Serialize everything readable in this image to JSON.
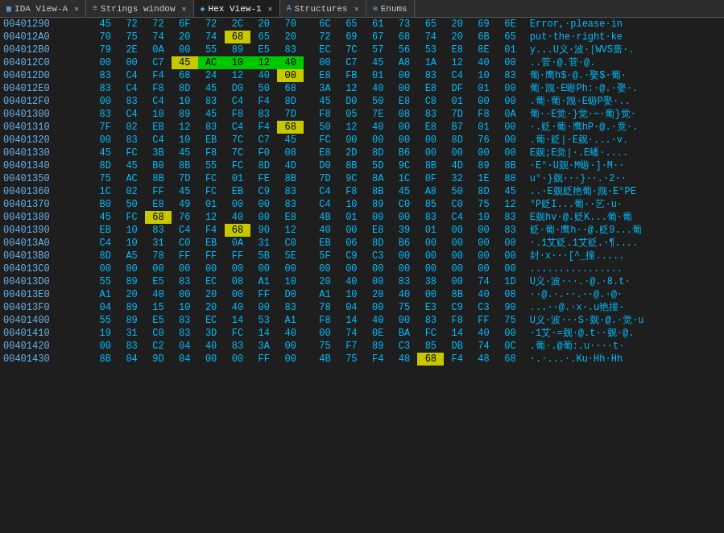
{
  "tabs": [
    {
      "id": "ida-view",
      "icon": "▦",
      "label": "IDA View-A",
      "active": false
    },
    {
      "id": "strings-window",
      "icon": "≡",
      "label": "Strings window",
      "active": false
    },
    {
      "id": "hex-view",
      "icon": "◈",
      "label": "Hex View-1",
      "active": true
    },
    {
      "id": "structures",
      "icon": "A",
      "label": "Structures",
      "active": false
    },
    {
      "id": "enums",
      "icon": "≋",
      "label": "Enums",
      "active": false
    }
  ],
  "rows": [
    {
      "addr": "00401290",
      "bytes": [
        "45",
        "72",
        "72",
        "6F",
        "72",
        "2C",
        "20",
        "70",
        "6C",
        "65",
        "61",
        "73",
        "65",
        "20",
        "69",
        "6E"
      ],
      "highlight": [],
      "ascii": "Error,·please·in"
    },
    {
      "addr": "004012A0",
      "bytes": [
        "70",
        "75",
        "74",
        "20",
        "74",
        "68",
        "65",
        "20",
        "72",
        "69",
        "67",
        "68",
        "74",
        "20",
        "6B",
        "65"
      ],
      "highlight": [
        5,
        11
      ],
      "ascii": "put·the·right·ke"
    },
    {
      "addr": "004012B0",
      "bytes": [
        "79",
        "2E",
        "0A",
        "00",
        "55",
        "89",
        "E5",
        "83",
        "EC",
        "7C",
        "57",
        "56",
        "53",
        "E8",
        "8E",
        "01"
      ],
      "highlight": [],
      "ascii": "y...U义·波·|WVS蔷·."
    },
    {
      "addr": "004012C0",
      "bytes": [
        "00",
        "00",
        "C7",
        "45",
        "AC",
        "10",
        "12",
        "40",
        "00",
        "C7",
        "45",
        "A8",
        "1A",
        "12",
        "40",
        "00"
      ],
      "highlight": [],
      "ascii": "..菅·@.菅·@."
    },
    {
      "addr": "004012D0",
      "bytes": [
        "83",
        "C4",
        "F4",
        "68",
        "24",
        "12",
        "40",
        "00",
        "E8",
        "FB",
        "01",
        "00",
        "83",
        "C4",
        "10",
        "83"
      ],
      "highlight": [
        3
      ],
      "ascii": "葡·鹰h$·@.·娶$·葡·"
    },
    {
      "addr": "004012E0",
      "bytes": [
        "83",
        "C4",
        "F8",
        "8D",
        "45",
        "D0",
        "50",
        "68",
        "3A",
        "12",
        "40",
        "00",
        "E8",
        "DF",
        "01",
        "00"
      ],
      "highlight": [
        7
      ],
      "ascii": "葡·觊·E蝣Ph:·@.·娶·."
    },
    {
      "addr": "004012F0",
      "bytes": [
        "00",
        "83",
        "C4",
        "10",
        "83",
        "C4",
        "F4",
        "8D",
        "45",
        "D0",
        "50",
        "E8",
        "C8",
        "01",
        "00",
        "00"
      ],
      "highlight": [],
      "ascii": ".葡·葡·觊·E蝣P娶·.."
    },
    {
      "addr": "00401300",
      "bytes": [
        "83",
        "C4",
        "10",
        "89",
        "45",
        "F8",
        "83",
        "7D",
        "F8",
        "05",
        "7E",
        "08",
        "83",
        "7D",
        "F8",
        "0A"
      ],
      "highlight": [],
      "ascii": "葡··E觉·}觉·~·葡}觉·"
    },
    {
      "addr": "00401310",
      "bytes": [
        "7F",
        "02",
        "EB",
        "12",
        "83",
        "C4",
        "F4",
        "68",
        "50",
        "12",
        "40",
        "00",
        "E8",
        "B7",
        "01",
        "00"
      ],
      "highlight": [
        7
      ],
      "ascii": "·.贬·葡·鹰hP·@.·竟·."
    },
    {
      "addr": "00401320",
      "bytes": [
        "00",
        "83",
        "C4",
        "10",
        "EB",
        "7C",
        "C7",
        "45",
        "FC",
        "00",
        "00",
        "00",
        "00",
        "8D",
        "76",
        "00"
      ],
      "highlight": [],
      "ascii": ".葡·贬|·E觌·...·v."
    },
    {
      "addr": "00401330",
      "bytes": [
        "45",
        "FC",
        "3B",
        "45",
        "F8",
        "7C",
        "F0",
        "08",
        "E8",
        "2D",
        "8D",
        "B6",
        "00",
        "00",
        "00",
        "00"
      ],
      "highlight": [],
      "ascii": "E觌;E觉|·.E蟠·...."
    },
    {
      "addr": "00401340",
      "bytes": [
        "8D",
        "45",
        "B0",
        "8B",
        "55",
        "FC",
        "8D",
        "4D",
        "D0",
        "8B",
        "5D",
        "9C",
        "8B",
        "4D",
        "89",
        "8B"
      ],
      "highlight": [],
      "ascii": "·E°·U觌·M蝣·]·M··"
    },
    {
      "addr": "00401350",
      "bytes": [
        "75",
        "AC",
        "8B",
        "7D",
        "FC",
        "01",
        "FE",
        "8B",
        "7D",
        "9C",
        "8A",
        "1C",
        "0F",
        "32",
        "1E",
        "88"
      ],
      "highlight": [],
      "ascii": "u°·}觌···}··.·2··"
    },
    {
      "addr": "00401360",
      "bytes": [
        "1C",
        "02",
        "FF",
        "45",
        "FC",
        "EB",
        "C9",
        "83",
        "C4",
        "F8",
        "8B",
        "45",
        "A8",
        "50",
        "8D",
        "45"
      ],
      "highlight": [],
      "ascii": "..·E觌贬艳葡·觊·E°PE"
    },
    {
      "addr": "00401370",
      "bytes": [
        "B0",
        "50",
        "E8",
        "49",
        "01",
        "00",
        "00",
        "83",
        "C4",
        "10",
        "89",
        "C0",
        "85",
        "C0",
        "75",
        "12"
      ],
      "highlight": [],
      "ascii": "°P贬I...葡··艺·u·"
    },
    {
      "addr": "00401380",
      "bytes": [
        "45",
        "FC",
        "68",
        "76",
        "12",
        "40",
        "00",
        "E8",
        "4B",
        "01",
        "00",
        "00",
        "83",
        "C4",
        "10",
        "83"
      ],
      "highlight": [
        2
      ],
      "ascii": "E觌hv·@.贬K...葡·葡"
    },
    {
      "addr": "00401390",
      "bytes": [
        "EB",
        "10",
        "83",
        "C4",
        "F4",
        "68",
        "90",
        "12",
        "40",
        "00",
        "E8",
        "39",
        "01",
        "00",
        "00",
        "83"
      ],
      "highlight": [
        5
      ],
      "ascii": "贬·葡·鹰h··@.贬9...葡"
    },
    {
      "addr": "004013A0",
      "bytes": [
        "C4",
        "10",
        "31",
        "C0",
        "EB",
        "0A",
        "31",
        "C0",
        "EB",
        "06",
        "8D",
        "B6",
        "00",
        "00",
        "00",
        "00"
      ],
      "highlight": [],
      "ascii": "·.1艾贬.1艾贬.·¶...."
    },
    {
      "addr": "004013B0",
      "bytes": [
        "8D",
        "A5",
        "78",
        "FF",
        "FF",
        "FF",
        "5B",
        "5E",
        "5F",
        "C9",
        "C3",
        "00",
        "00",
        "00",
        "00",
        "00"
      ],
      "highlight": [],
      "ascii": "封·x···[^_撞....."
    },
    {
      "addr": "004013C0",
      "bytes": [
        "00",
        "00",
        "00",
        "00",
        "00",
        "00",
        "00",
        "00",
        "00",
        "00",
        "00",
        "00",
        "00",
        "00",
        "00",
        "00"
      ],
      "highlight": [],
      "ascii": "................"
    },
    {
      "addr": "004013D0",
      "bytes": [
        "55",
        "89",
        "E5",
        "83",
        "EC",
        "08",
        "A1",
        "10",
        "20",
        "40",
        "00",
        "83",
        "38",
        "00",
        "74",
        "1D"
      ],
      "highlight": [],
      "ascii": "U义·波···.·@.·8.t·"
    },
    {
      "addr": "004013E0",
      "bytes": [
        "A1",
        "20",
        "40",
        "00",
        "20",
        "00",
        "FF",
        "D0",
        "A1",
        "10",
        "20",
        "40",
        "00",
        "8B",
        "40",
        "08"
      ],
      "highlight": [],
      "ascii": "··@.·.··.··@.·@·"
    },
    {
      "addr": "004013F0",
      "bytes": [
        "04",
        "89",
        "15",
        "10",
        "20",
        "40",
        "00",
        "83",
        "78",
        "04",
        "00",
        "75",
        "E3",
        "C9",
        "C3",
        "90"
      ],
      "highlight": [],
      "ascii": "...··@.·x·.u艳撞·"
    },
    {
      "addr": "00401400",
      "bytes": [
        "55",
        "89",
        "E5",
        "83",
        "EC",
        "14",
        "53",
        "A1",
        "F8",
        "14",
        "40",
        "00",
        "83",
        "F8",
        "FF",
        "75"
      ],
      "highlight": [],
      "ascii": "U义·波···S·觌·@.·觉·u"
    },
    {
      "addr": "00401410",
      "bytes": [
        "19",
        "31",
        "C0",
        "83",
        "3D",
        "FC",
        "14",
        "40",
        "00",
        "74",
        "0E",
        "BA",
        "FC",
        "14",
        "40",
        "00"
      ],
      "highlight": [],
      "ascii": "·1艾·=觌·@.t··觌·@."
    },
    {
      "addr": "00401420",
      "bytes": [
        "00",
        "83",
        "C2",
        "04",
        "40",
        "83",
        "3A",
        "00",
        "75",
        "F7",
        "89",
        "C3",
        "85",
        "DB",
        "74",
        "0C"
      ],
      "highlight": [],
      "ascii": ".葡·.@葡:.u····t·"
    },
    {
      "addr": "00401430",
      "bytes": [
        "8B",
        "04",
        "9D",
        "04",
        "00",
        "00",
        "FF",
        "00",
        "4B",
        "75",
        "F4",
        "48",
        "68",
        "F4",
        "48",
        "68"
      ],
      "highlight": [
        12
      ],
      "ascii": "·.·...·.Ku·Hh·Hh"
    }
  ]
}
